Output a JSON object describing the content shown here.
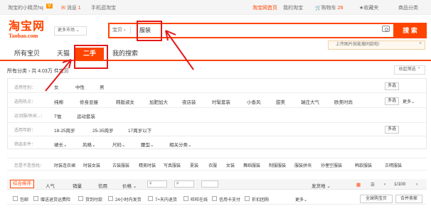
{
  "topbar": {
    "greeting": "淘宝的小精灵hq",
    "greeting_badge": "V",
    "messages": "消息",
    "message_count": "1",
    "mobile": "手机逛淘宝",
    "home": "淘宝网首页",
    "my_taobao": "我的淘宝",
    "cart": "购物车",
    "cart_count": "26",
    "favorites": "收藏夹",
    "categories": "商品分类"
  },
  "logo": {
    "cn": "淘宝网",
    "en": "Taobao.com"
  },
  "search": {
    "market": "更多市场",
    "tab": "宝贝",
    "value": "服装",
    "button": "搜 索",
    "tip": "上传图片就能搜同款啦!"
  },
  "tabs": [
    "所有宝贝",
    "天猫",
    "二手",
    "我的搜索"
  ],
  "crumb": {
    "all": "所有分类",
    "count": "共 4.03万 件宝贝"
  },
  "collapse": "收起筛选",
  "attributes": [
    {
      "label": "适用性别：",
      "values": [
        "女",
        "中性",
        "男"
      ],
      "multi": "多选",
      "more": ""
    },
    {
      "label": "选购热点：",
      "values": [
        "纯棉",
        "修身显瘦",
        "韩版淑女",
        "加肥加大",
        "夜店装",
        "时髦套装",
        "小香风",
        "甜美",
        "瑞庄大气",
        "欧美时尚"
      ],
      "multi": "多选",
      "more": "更多"
    },
    {
      "label": "运动服/休闲...：",
      "values": [
        "T恤",
        "运动套装"
      ],
      "multi": "",
      "more": ""
    },
    {
      "label": "适用年龄：",
      "values": [
        "18-25周岁",
        "25-35周岁",
        "17周岁以下"
      ],
      "multi": "多选",
      "more": ""
    },
    {
      "label": "筛选条件：",
      "values": [
        "裙长",
        "风格",
        "尺码",
        "腰型",
        "相关分类"
      ],
      "multi": "",
      "more": ""
    }
  ],
  "related": {
    "label": "您是不是想找：",
    "items": [
      "时装连衣裙",
      "时装女装",
      "古装服装",
      "精美时装",
      "写真服装",
      "夏装",
      "衣服",
      "女装",
      "舞蹈服装",
      "制服服装",
      "服装拼块",
      "孙俚空服装",
      "韩款服装",
      "古晴服装"
    ]
  },
  "sort": {
    "items": [
      "综合排序",
      "人气",
      "销量",
      "信用",
      "价格"
    ],
    "price_from": "¥",
    "price_to": "¥",
    "ship_from": "发货地",
    "page": "1/100"
  },
  "filters": {
    "items": [
      "包邮",
      "赠送退货运费险",
      "货到付款",
      "24小时内发货",
      "7+天内退货",
      "旺旺在线",
      "信用卡支付",
      "折扣团购"
    ],
    "more": "更多",
    "btn_global": "全球购宝贝",
    "btn_hk": "合并卖家"
  },
  "colors": {
    "brand": "#ff4400",
    "annotation": "#e21a1a"
  }
}
